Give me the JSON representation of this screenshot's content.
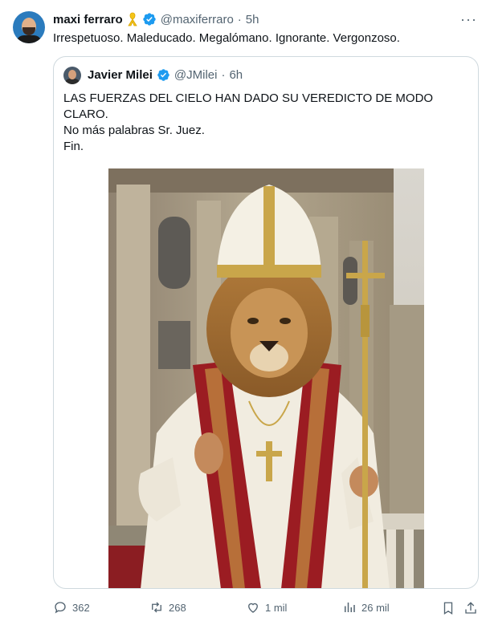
{
  "tweet": {
    "author_name": "maxi ferraro",
    "author_handle": "@maxiferraro",
    "separator": "·",
    "time": "5h",
    "badge_icon": "yellow-ribbon-icon",
    "text": "Irrespetuoso. Maleducado. Megalómano. Ignorante. Vergonzoso.",
    "more_label": "···"
  },
  "quote": {
    "author_name": "Javier Milei",
    "author_handle": "@JMilei",
    "separator": "·",
    "time": "6h",
    "lines": [
      "LAS FUERZAS DEL CIELO HAN DADO SU VEREDICTO DE MODO",
      "CLARO.",
      "No más palabras Sr. Juez.",
      "Fin."
    ]
  },
  "actions": {
    "replies": "362",
    "retweets": "268",
    "likes": "1 mil",
    "views": "26 mil"
  },
  "colors": {
    "text": "#0f1419",
    "secondary": "#536471",
    "verified": "#1d9bf0",
    "border": "#cfd9de"
  }
}
